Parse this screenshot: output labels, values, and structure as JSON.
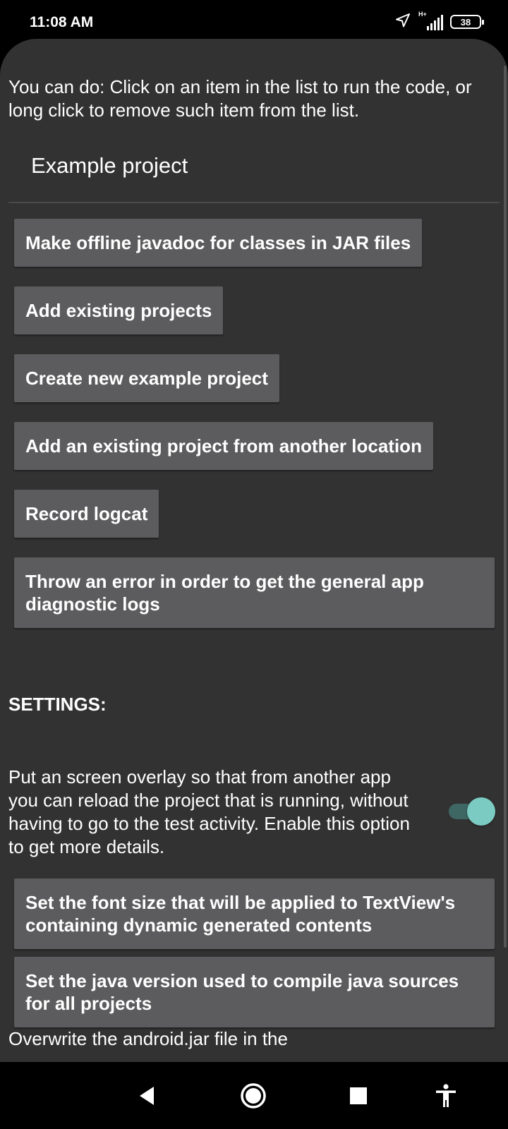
{
  "status_bar": {
    "time": "11:08 AM",
    "network_type": "H+",
    "battery_level": "38",
    "icons": [
      "location-arrow-icon",
      "signal-icon",
      "battery-icon"
    ]
  },
  "content": {
    "intro_text": "You can do: Click on an item in the list to run the code, or long click to remove such item from the list.",
    "project_title": "Example project",
    "actions": [
      "Make offline javadoc for classes in JAR files",
      "Add existing projects",
      "Create new example project",
      "Add an existing project from another location",
      "Record logcat",
      "Throw an error in order to get the general app diagnostic logs"
    ],
    "settings": {
      "title": "SETTINGS:",
      "overlay_description": "Put an screen overlay so that from another app you can reload the project that is running, without having to go to the test activity. Enable this option to get more details.",
      "overlay_enabled": true,
      "font_size_button": "Set the font size that will be applied to TextView's containing dynamic generated contents",
      "java_version_button": "Set the java version used to compile java sources for all projects",
      "android_jar_text": "Overwrite the android.jar file in the"
    }
  },
  "nav_bar": {
    "buttons": [
      "back-icon",
      "home-icon",
      "recents-icon",
      "accessibility-icon"
    ]
  },
  "colors": {
    "background": "#323232",
    "button": "#5c5c5e",
    "toggle_thumb": "#7ccbc2",
    "toggle_track": "#3e6764"
  }
}
